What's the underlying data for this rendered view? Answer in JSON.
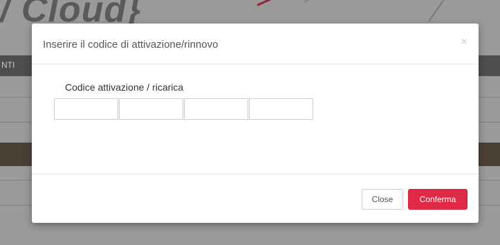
{
  "background": {
    "logo_text": "/ Cloud}",
    "nav_label": "NTI"
  },
  "dialog": {
    "title": "Inserire il codice di attivazione/rinnovo",
    "close_icon": "×",
    "field_label": "Codice attivazione / ricarica",
    "code_segments": [
      "",
      "",
      "",
      ""
    ],
    "buttons": {
      "close_label": "Close",
      "confirm_label": "Conferma"
    }
  },
  "colors": {
    "accent": "#e02946",
    "overlay": "#9a9a9a"
  }
}
